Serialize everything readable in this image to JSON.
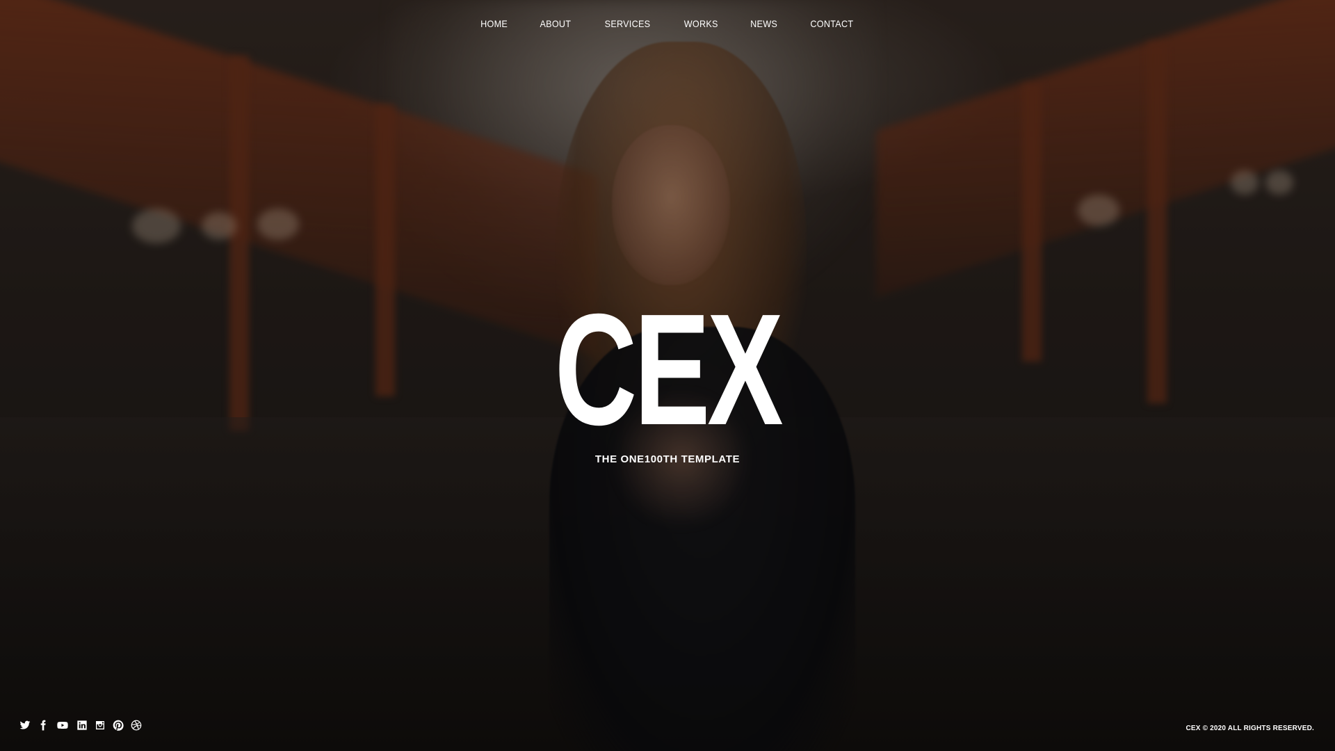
{
  "nav": {
    "items": [
      {
        "label": "HOME"
      },
      {
        "label": "ABOUT"
      },
      {
        "label": "SERVICES"
      },
      {
        "label": "WORKS"
      },
      {
        "label": "NEWS"
      },
      {
        "label": "CONTACT"
      }
    ]
  },
  "hero": {
    "title": "CEX",
    "tagline": "THE ONE100TH TEMPLATE"
  },
  "social": {
    "icons": [
      "twitter-icon",
      "facebook-icon",
      "youtube-icon",
      "linkedin-icon",
      "instagram-icon",
      "pinterest-icon",
      "dribbble-icon"
    ]
  },
  "footer": {
    "copyright": "CEX © 2020 ALL RIGHTS RESERVED."
  },
  "colors": {
    "text": "#ffffff",
    "background_dark": "#1d1916",
    "accent_warm": "#8c3c1e"
  }
}
